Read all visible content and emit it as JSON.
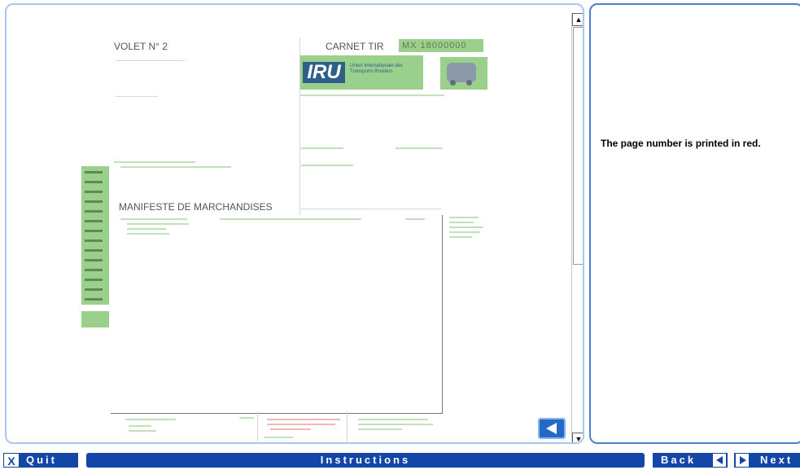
{
  "document": {
    "left_title": "VOLET N° 2",
    "right_title": "CARNET TIR",
    "serial": "MX 18000000",
    "logo_text": "IRU",
    "logo_caption": "Union Internationale des Transports Routiers",
    "manifest_title": "MANIFESTE DE MARCHANDISES"
  },
  "info": {
    "text": "The page number is printed in red."
  },
  "bottom_bar": {
    "quit_x": "X",
    "quit_label": "Quit",
    "instructions_label": "Instructions",
    "back_label": "Back",
    "next_label": "Next"
  },
  "colors": {
    "nav_blue": "#1446a8",
    "highlight_green": "#9bd08c",
    "panel_border": "#4d7ecf"
  },
  "icons": {
    "scroll_up": "triangle-up",
    "scroll_down": "triangle-down",
    "page_back": "arrow-left",
    "back": "arrow-left",
    "next": "arrow-right",
    "truck": "truck"
  }
}
